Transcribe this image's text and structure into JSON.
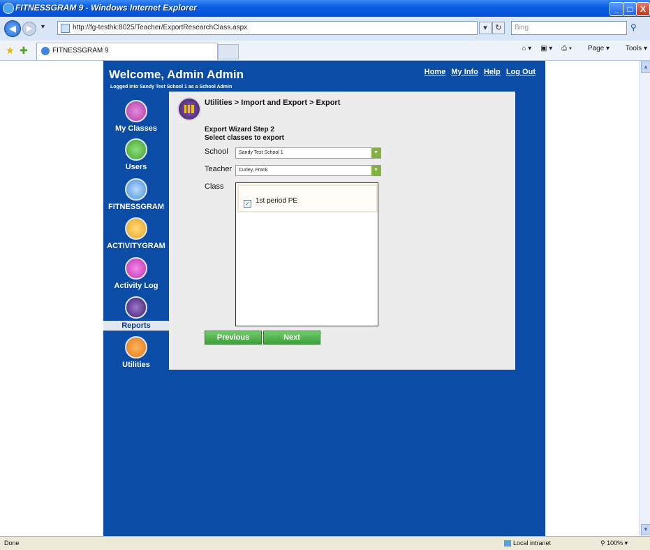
{
  "window": {
    "title": "FITNESSGRAM 9 - Windows Internet Explorer",
    "minimize_glyph": "_",
    "maximize_glyph": "□",
    "close_glyph": "X"
  },
  "browser": {
    "url": "http://fg-testhk:8025/Teacher/ExportResearchClass.aspx",
    "search_placeholder": "Bing",
    "tab_title": "FITNESSGRAM 9",
    "commands": {
      "page": "Page",
      "tools": "Tools"
    },
    "status": {
      "left": "Done",
      "zone": "Local intranet",
      "zoom": "100%"
    }
  },
  "header": {
    "welcome": "Welcome, Admin Admin",
    "logged_in": "Logged into Sandy Test School 1 as a School Admin",
    "links": {
      "home": "Home",
      "my_info": "My Info",
      "help": "Help",
      "log_out": "Log Out"
    }
  },
  "sidebar": {
    "items": [
      {
        "label": "My Classes",
        "icon": "my-classes-icon",
        "color": "#b03aa6"
      },
      {
        "label": "Users",
        "icon": "users-icon",
        "color": "#3fa12f"
      },
      {
        "label": "FITNESSGRAM",
        "icon": "fitnessgram-icon",
        "color": "#4a8fd6"
      },
      {
        "label": "ACTIVITYGRAM",
        "icon": "activitygram-icon",
        "color": "#e6a623"
      },
      {
        "label": "Activity Log",
        "icon": "activity-log-icon",
        "color": "#c02fb0"
      },
      {
        "label": "Reports",
        "icon": "reports-icon",
        "color": "#6a3d98"
      },
      {
        "label": "Utilities",
        "icon": "utilities-icon",
        "color": "#e07a1c"
      }
    ],
    "active": "Reports"
  },
  "main": {
    "breadcrumb": "Utilities > Import and Export > Export",
    "step_title": "Export Wizard Step 2",
    "step_subtitle": "Select classes to export",
    "school_label": "School",
    "school_value": "Sandy Test School 1",
    "teacher_label": "Teacher",
    "teacher_value": "Curley, Frank",
    "class_label": "Class",
    "classes": [
      {
        "name": "1st period PE",
        "checked": true
      }
    ],
    "previous_button": "Previous",
    "next_button": "Next"
  },
  "colors": {
    "panel_blue": "#0b4ca7",
    "button_green": "#4cad48",
    "content_gray": "#ececec"
  }
}
